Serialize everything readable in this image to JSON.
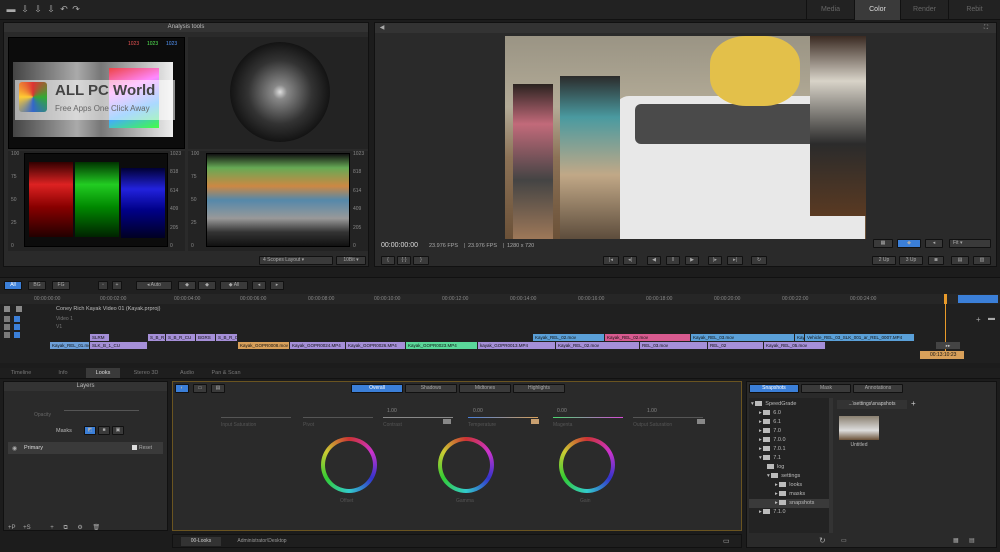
{
  "mode_tabs": [
    {
      "label": "Media",
      "active": false
    },
    {
      "label": "Color",
      "active": true
    },
    {
      "label": "Render",
      "active": false
    },
    {
      "label": "Rebit",
      "active": false
    }
  ],
  "analysis": {
    "title": "Analysis tools",
    "rgb_tags": [
      "1023",
      "1023",
      "1023"
    ],
    "layout_select": "4 Scopes Layout",
    "bit_select": "10Bit",
    "waveform_ticks": [
      "100",
      "75",
      "50",
      "25",
      "0"
    ],
    "waveform_ticks_right": [
      "1023",
      "818",
      "614",
      "409",
      "205",
      "0"
    ],
    "parade_ticks": [
      "100",
      "75",
      "50",
      "25",
      "0"
    ],
    "parade_ticks_right": [
      "1023",
      "818",
      "614",
      "409",
      "205",
      "0"
    ]
  },
  "watermark": {
    "title": "ALL PC World",
    "subtitle": "Free Apps One Click Away"
  },
  "viewer": {
    "timecode": "00:00:00:00",
    "fps1": "23.976 FPS",
    "fps2": "23.976 FPS",
    "resolution": "1280 x 720",
    "zoom_select": "Fit",
    "up2": "2 Up",
    "up3": "3 Up",
    "pip_color": "#3b7fd8"
  },
  "timeline": {
    "filter_tabs": [
      "All",
      "BG",
      "FG"
    ],
    "auto_label": "Auto",
    "all_label": "All",
    "ruler": [
      "00:00:00:00",
      "00:00:02:00",
      "00:00:04:00",
      "00:00:06:00",
      "00:00:08:00",
      "00:00:10:00",
      "00:00:12:00",
      "00:00:14:00",
      "00:00:16:00",
      "00:00:18:00",
      "00:00:20:00",
      "00:00:22:00",
      "00:00:24:00"
    ],
    "track_title": "Coney Rich Kayak Video 01 (Kayak.prproj)",
    "track_v1": "Video 1",
    "track_v2": "V1",
    "end_timecode": "00:13:10:23",
    "row1": [
      {
        "t": "Kayak_REL_02.mov",
        "c": "#5aa0d8"
      },
      {
        "t": "Kayak_REL_02.mov",
        "c": "#d85a8f"
      },
      {
        "t": "Kayak_REL_03.mov",
        "c": "#5aa0d8"
      },
      {
        "t": "Kayak_REL_03.mov",
        "c": "#5aa0d8"
      },
      {
        "t": "Vehicle_REL_03_SLK_001_ar_REL_0007.MP4",
        "c": "#5aa0d8"
      }
    ],
    "row2": [
      {
        "t": "SLRM",
        "c": "#a58fd8"
      },
      {
        "t": "S_B_R_CU",
        "c": "#a58fd8"
      },
      {
        "t": "S_B_R_CU",
        "c": "#a58fd8"
      },
      {
        "t": "BGRS",
        "c": "#a58fd8"
      },
      {
        "t": "S_B_R_CU",
        "c": "#a58fd8"
      }
    ],
    "row3": [
      {
        "t": "Kayak_REL_01.mov",
        "c": "#6d9fd8"
      },
      {
        "t": "SLK_B_1_CU",
        "c": "#a58fd8"
      },
      {
        "t": "Kayak_GOPR0008.mov",
        "c": "#d8a05a"
      },
      {
        "t": "Kayak_GOPR0024.MP4",
        "c": "#a58fd8"
      },
      {
        "t": "Kayak_GOPR0026.MP4",
        "c": "#a58fd8"
      },
      {
        "t": "Kayak_GOPR0023.MP4",
        "c": "#5ad89a"
      },
      {
        "t": "kayak_GOPR0013.MP4",
        "c": "#a58fd8"
      },
      {
        "t": "Kayak_REL_02.mov",
        "c": "#a58fd8"
      },
      {
        "t": "REL_03.mov",
        "c": "#a58fd8"
      },
      {
        "t": "REL_02",
        "c": "#a58fd8"
      },
      {
        "t": "Kayak_REL_05.mov",
        "c": "#a58fd8"
      }
    ]
  },
  "bottom_tabs": [
    "Timeline",
    "Info",
    "Looks",
    "Stereo 3D",
    "Audio",
    "Pan & Scan"
  ],
  "layers": {
    "title": "Layers",
    "opacity": "Opacity",
    "masks": "Masks",
    "primary": "Primary",
    "reset": "Reset"
  },
  "grade_tabs": [
    "Overall",
    "Shadows",
    "Midtones",
    "Highlights"
  ],
  "grade_sliders": [
    "Input Saturation",
    "Pivot",
    "Contrast",
    "Temperature",
    "Magenta",
    "Output Saturation"
  ],
  "slider_values": [
    "1.00",
    "0.00",
    "1.00",
    "0.00",
    "0.00",
    "1.00"
  ],
  "wheels": [
    "Offset",
    "Gamma",
    "Gain"
  ],
  "bottom_status": {
    "tab1": "00-Looks",
    "tab2": "Administrator\\Desktop"
  },
  "snapshots": {
    "tabs": [
      "Snapshots",
      "Mask",
      "Annotations"
    ],
    "path": "...\\settings\\snapshots",
    "thumb_label": "Untitled",
    "tree": [
      {
        "label": "SpeedGrade",
        "depth": 0
      },
      {
        "label": "6.0",
        "depth": 1
      },
      {
        "label": "6.1",
        "depth": 1
      },
      {
        "label": "7.0",
        "depth": 1
      },
      {
        "label": "7.0.0",
        "depth": 1
      },
      {
        "label": "7.0.1",
        "depth": 1
      },
      {
        "label": "7.1",
        "depth": 1
      },
      {
        "label": "log",
        "depth": 2
      },
      {
        "label": "settings",
        "depth": 2
      },
      {
        "label": "looks",
        "depth": 3
      },
      {
        "label": "masks",
        "depth": 3
      },
      {
        "label": "snapshots",
        "depth": 3
      },
      {
        "label": "7.1.0",
        "depth": 1
      }
    ]
  }
}
